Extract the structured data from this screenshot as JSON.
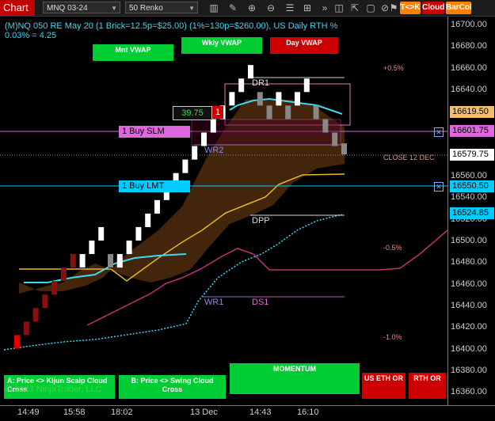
{
  "toolbar": {
    "tab": "Chart",
    "instrument": "MNQ 03-24",
    "period": "50 Renko",
    "icons": [
      "bars-icon",
      "pencil-icon",
      "zoom-in-icon",
      "zoom-out-icon",
      "properties-icon",
      "draw-objects-icon",
      "fast-forward-icon",
      "screenshot-icon",
      "share-icon",
      "maximize-icon",
      "trade-icon",
      "flag-icon"
    ],
    "tk_label": "T<>K",
    "cloud_label": "Cloud",
    "barcol_label": "BarCol",
    "tk_color": "#ff8000",
    "cloud_color": "#cc0000",
    "barcol_color": "#ff8000"
  },
  "chart": {
    "title": "(M)NQ 050 RE May 20 (1 Brick=12.5p=$25.00) (1%=130p=$260.00), US Daily RTH %",
    "subtitle": "0.03% = 4.25",
    "vwap_buttons": {
      "monthly": "Mnt VWAP",
      "weekly": "Wkly VWAP",
      "daily": "Day VWAP"
    },
    "levels": {
      "dr1": "DR1",
      "wr2": "WR2",
      "dpp": "DPP",
      "wr1": "WR1",
      "ds1": "DS1",
      "close": "CLOSE 12 DEC",
      "pct_plus": "+0.5%",
      "pct_minus_half": "-0.5%",
      "pct_minus_one": "-1.0%"
    },
    "order_qty_box": "39.75",
    "order_qty": "1",
    "orders": [
      {
        "label": "1 Buy SLM",
        "price": "16601.75",
        "color": "#e066e0"
      },
      {
        "label": "1 Buy LMT",
        "price": "16550.50",
        "color": "#00ccff"
      }
    ],
    "price_axis": [
      "16700.00",
      "16680.00",
      "16660.00",
      "16640.00",
      "16620.00",
      "16600.00",
      "16580.00",
      "16560.00",
      "16540.00",
      "16520.00",
      "16500.00",
      "16480.00",
      "16460.00",
      "16440.00",
      "16420.00",
      "16400.00",
      "16380.00",
      "16360.00"
    ],
    "price_tags": {
      "last": "16619.50",
      "close": "16579.75",
      "cyan": "16524.85"
    },
    "time_axis": [
      "14:49",
      "15:58",
      "18:02",
      "13 Dec",
      "14:43",
      "16:10"
    ],
    "bottom_buttons": {
      "kijun": "A: Price <> Kijun Scalp Cloud Cross",
      "swing": "B: Price <> Swing Cloud Cross",
      "momentum": "MOMENTUM",
      "us_eth": "US ETH OR",
      "rth": "RTH OR"
    },
    "copyright": "© 2023 NinjaTrader, LLC"
  },
  "chart_data": {
    "type": "renko",
    "bricks": [
      {
        "o": 16412.5,
        "c": 16400,
        "dir": "down"
      },
      {
        "o": 16425,
        "c": 16412.5,
        "dir": "down"
      },
      {
        "o": 16437.5,
        "c": 16425,
        "dir": "down"
      },
      {
        "o": 16450,
        "c": 16437.5,
        "dir": "down"
      },
      {
        "o": 16462.5,
        "c": 16450,
        "dir": "down"
      },
      {
        "o": 16475,
        "c": 16462.5,
        "dir": "down"
      },
      {
        "o": 16487.5,
        "c": 16475,
        "dir": "down"
      },
      {
        "o": 16475,
        "c": 16487.5,
        "dir": "up"
      },
      {
        "o": 16487.5,
        "c": 16500,
        "dir": "up"
      },
      {
        "o": 16500,
        "c": 16512.5,
        "dir": "up"
      },
      {
        "o": 16487.5,
        "c": 16475,
        "dir": "grey"
      },
      {
        "o": 16475,
        "c": 16487.5,
        "dir": "up"
      },
      {
        "o": 16487.5,
        "c": 16500,
        "dir": "up"
      },
      {
        "o": 16500,
        "c": 16512.5,
        "dir": "up"
      },
      {
        "o": 16512.5,
        "c": 16525,
        "dir": "up"
      },
      {
        "o": 16525,
        "c": 16537.5,
        "dir": "up"
      },
      {
        "o": 16537.5,
        "c": 16550,
        "dir": "up"
      },
      {
        "o": 16550,
        "c": 16562.5,
        "dir": "up"
      },
      {
        "o": 16562.5,
        "c": 16575,
        "dir": "up"
      },
      {
        "o": 16575,
        "c": 16587.5,
        "dir": "up"
      },
      {
        "o": 16587.5,
        "c": 16600,
        "dir": "up"
      },
      {
        "o": 16600,
        "c": 16612.5,
        "dir": "up"
      },
      {
        "o": 16612.5,
        "c": 16625,
        "dir": "up"
      },
      {
        "o": 16625,
        "c": 16637.5,
        "dir": "up"
      },
      {
        "o": 16637.5,
        "c": 16650,
        "dir": "up"
      },
      {
        "o": 16650,
        "c": 16662.5,
        "dir": "up"
      },
      {
        "o": 16637.5,
        "c": 16625,
        "dir": "grey"
      },
      {
        "o": 16625,
        "c": 16612.5,
        "dir": "grey"
      },
      {
        "o": 16625,
        "c": 16637.5,
        "dir": "up"
      },
      {
        "o": 16625,
        "c": 16612.5,
        "dir": "grey"
      },
      {
        "o": 16625,
        "c": 16637.5,
        "dir": "up"
      },
      {
        "o": 16637.5,
        "c": 16650,
        "dir": "up"
      },
      {
        "o": 16625,
        "c": 16612.5,
        "dir": "grey"
      },
      {
        "o": 16612.5,
        "c": 16600,
        "dir": "grey"
      },
      {
        "o": 16600,
        "c": 16587.5,
        "dir": "grey"
      },
      {
        "o": 16590,
        "c": 16579.75,
        "dir": "grey"
      }
    ],
    "ylim": [
      16360,
      16710
    ]
  }
}
